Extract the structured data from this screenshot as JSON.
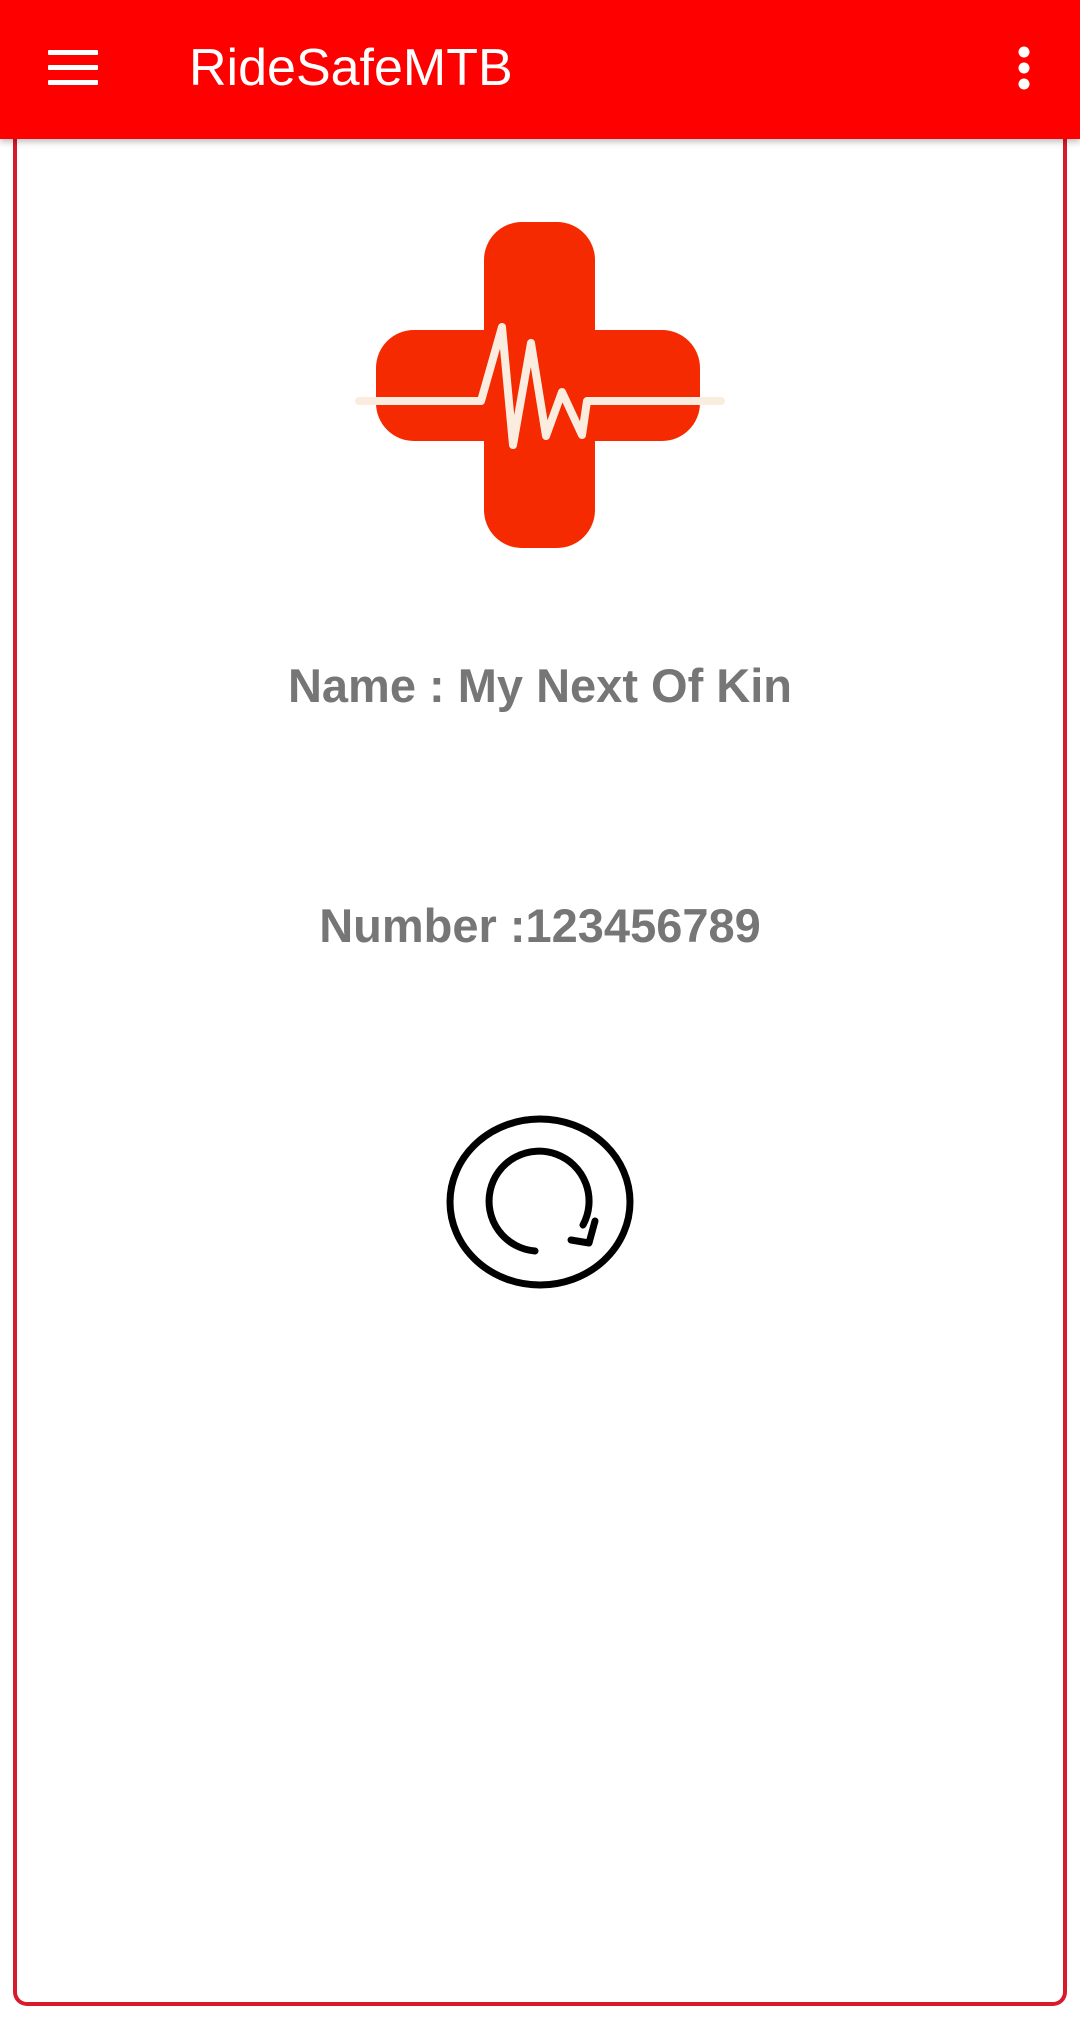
{
  "appbar": {
    "title": "RideSafeMTB",
    "menu_icon": "hamburger-menu-icon",
    "overflow_icon": "more-vert-icon",
    "background_color": "#ff0000"
  },
  "logo": {
    "icon": "medical-cross-heartbeat-logo",
    "cross_color": "#f52a00",
    "pulse_color": "#fbece0"
  },
  "contact": {
    "name_label": "Name : ",
    "name_value": "My Next Of Kin",
    "number_label": "Number :",
    "number_value": "123456789"
  },
  "refresh": {
    "icon": "refresh-icon"
  },
  "frame_border_color": "#d81b2a"
}
